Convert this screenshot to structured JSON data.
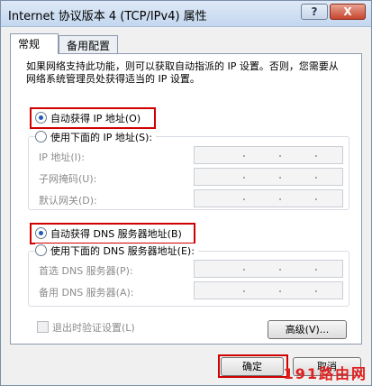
{
  "window": {
    "title": "Internet 协议版本 4 (TCP/IPv4) 属性",
    "help_label": "?",
    "close_label": "X"
  },
  "tabs": [
    {
      "label": "常规"
    },
    {
      "label": "备用配置"
    }
  ],
  "description": "如果网络支持此功能，则可以获取自动指派的 IP 设置。否则，您需要从网络系统管理员处获得适当的 IP 设置。",
  "ip_section": {
    "auto_label": "自动获得 IP 地址(O)",
    "manual_label": "使用下面的 IP 地址(S):",
    "auto_selected": true,
    "fields": [
      {
        "label": "IP 地址(I):"
      },
      {
        "label": "子网掩码(U):"
      },
      {
        "label": "默认网关(D):"
      }
    ]
  },
  "dns_section": {
    "auto_label": "自动获得 DNS 服务器地址(B)",
    "manual_label": "使用下面的 DNS 服务器地址(E):",
    "auto_selected": true,
    "fields": [
      {
        "label": "首选 DNS 服务器(P):"
      },
      {
        "label": "备用 DNS 服务器(A):"
      }
    ]
  },
  "validate_on_exit": {
    "label": "退出时验证设置(L)",
    "checked": false
  },
  "buttons": {
    "advanced": "高级(V)...",
    "ok": "确定",
    "cancel": "取消"
  },
  "watermark": "191路由网",
  "colors": {
    "highlight_box": "#d00000",
    "watermark": "#e02020"
  }
}
